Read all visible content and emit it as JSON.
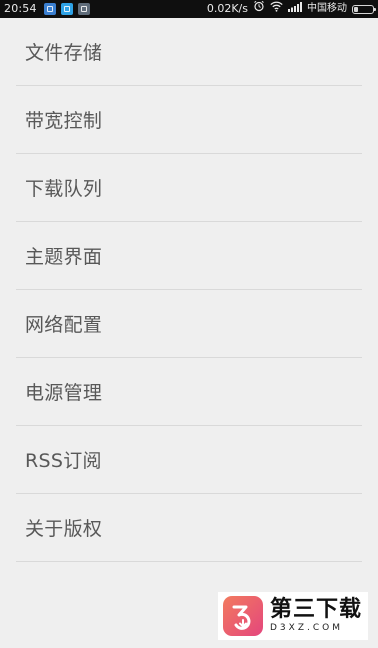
{
  "status_bar": {
    "time": "20:54",
    "network_speed": "0.02K/s",
    "carrier": "中国移动",
    "notification_icons": [
      "app-notification-icon",
      "app-notification-icon",
      "app-notification-icon"
    ],
    "battery_level_fraction": 0.2
  },
  "settings": {
    "items": [
      {
        "label": "文件存储"
      },
      {
        "label": "带宽控制"
      },
      {
        "label": "下载队列"
      },
      {
        "label": "主题界面"
      },
      {
        "label": "网络配置"
      },
      {
        "label": "电源管理"
      },
      {
        "label": "RSS订阅"
      },
      {
        "label": "关于版权"
      }
    ]
  },
  "watermark": {
    "title": "第三下载",
    "domain": "D3XZ.COM",
    "accent_color": "#e8556c"
  }
}
